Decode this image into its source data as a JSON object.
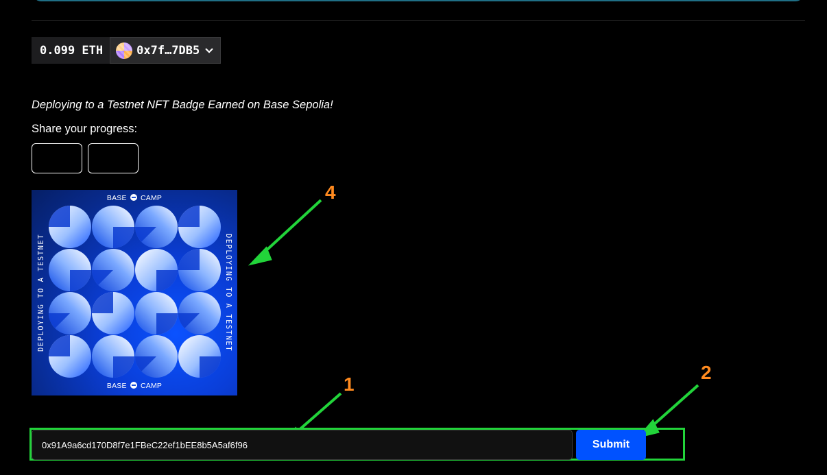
{
  "wallet": {
    "balance": "0.099 ETH",
    "address": "0x7f…7DB5",
    "chevron": "❯"
  },
  "page": {
    "badge_message": "Deploying to a Testnet NFT Badge Earned on Base Sepolia!",
    "share_label": "Share your progress:",
    "share_buttons": [
      "",
      ""
    ]
  },
  "badge": {
    "brand_left": "BASE",
    "brand_right": "CAMP",
    "side_text": "DEPLOYING TO A TESTNET"
  },
  "form": {
    "input_value": "0x91A9a6cd170D8f7e1FBeC22ef1bEE8b5A5af6f96",
    "submit_label": "Submit"
  },
  "annotations": {
    "labels": [
      "1",
      "2",
      "4"
    ],
    "arrow_color": "#22d43a",
    "label_color": "#ff8a1f"
  },
  "colors": {
    "accent": "#0052ff",
    "highlight": "#22d43a"
  }
}
